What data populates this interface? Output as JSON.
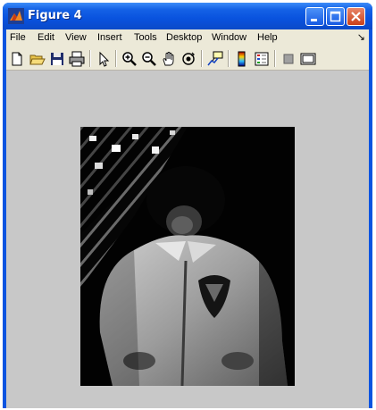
{
  "window": {
    "title": "Figure 4",
    "colors": {
      "titlebar": "#0a54e0",
      "client": "#d4d0c8",
      "plot_background": "#c8c8c8"
    }
  },
  "menubar": {
    "items": [
      "File",
      "Edit",
      "View",
      "Insert",
      "Tools",
      "Desktop",
      "Window",
      "Help"
    ],
    "overflow_icon": "dock-arrow-icon"
  },
  "toolbar": {
    "buttons": [
      "new-figure-icon",
      "open-file-icon",
      "save-icon",
      "print-icon",
      "edit-plot-arrow-icon",
      "zoom-in-icon",
      "zoom-out-icon",
      "pan-hand-icon",
      "rotate-3d-icon",
      "data-cursor-icon",
      "insert-colorbar-icon",
      "insert-legend-icon",
      "hide-plot-tools-icon",
      "show-plot-tools-icon"
    ]
  },
  "figure": {
    "content": "grayscale-image-child-in-jacket"
  }
}
